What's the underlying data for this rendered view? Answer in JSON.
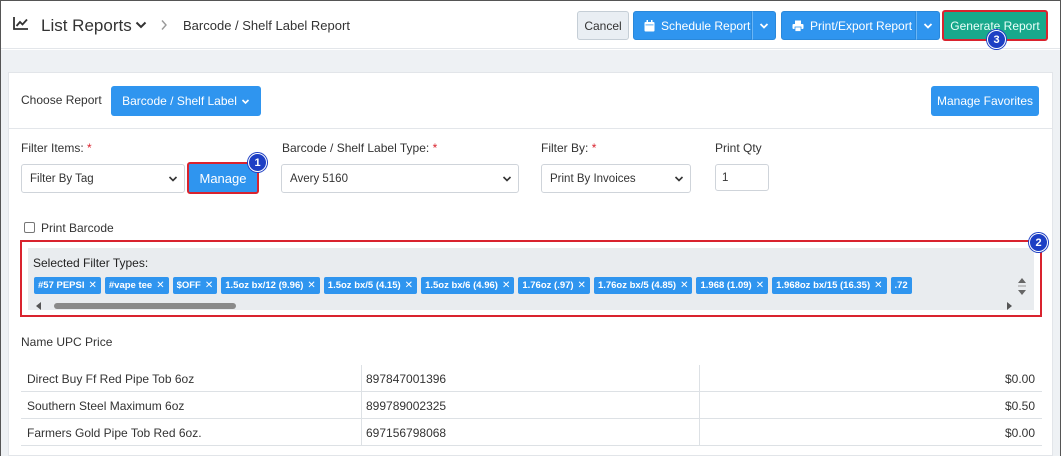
{
  "header": {
    "app_title": "List Reports",
    "breadcrumb": "Barcode / Shelf Label Report",
    "cancel_label": "Cancel",
    "schedule_label": "Schedule Report",
    "print_export_label": "Print/Export Report",
    "generate_label": "Generate Report"
  },
  "controls": {
    "choose_report_label": "Choose Report",
    "report_dropdown_label": "Barcode / Shelf Label",
    "manage_favorites_label": "Manage Favorites",
    "filter_items_label": "Filter Items:",
    "filter_items_value": "Filter By Tag",
    "manage_label": "Manage",
    "label_type_label": "Barcode / Shelf Label Type:",
    "label_type_value": "Avery 5160",
    "filter_by_label": "Filter By:",
    "filter_by_value": "Print By Invoices",
    "print_qty_label": "Print Qty",
    "print_qty_value": "1",
    "required_mark": "*",
    "print_barcode_label": "Print Barcode",
    "print_barcode_checked": false
  },
  "filters": {
    "title": "Selected Filter Types:",
    "chips": [
      "#57 PEPSI",
      "#vape tee",
      "$OFF",
      "1.5oz bx/12 (9.96)",
      "1.5oz bx/5 (4.15)",
      "1.5oz bx/6 (4.96)",
      "1.76oz (.97)",
      "1.76oz bx/5 (4.85)",
      "1.968 (1.09)",
      "1.968oz bx/15 (16.35)",
      ".72"
    ]
  },
  "callouts": [
    "1",
    "2",
    "3"
  ],
  "table": {
    "headers": {
      "name": "Name",
      "upc": "UPC",
      "price": "Price"
    },
    "rows": [
      {
        "name": "Direct Buy Ff Red Pipe Tob 6oz",
        "upc": "897847001396",
        "price": "$0.00"
      },
      {
        "name": "Southern Steel Maximum 6oz",
        "upc": "899789002325",
        "price": "$0.50"
      },
      {
        "name": "Farmers Gold Pipe Tob Red 6oz.",
        "upc": "697156798068",
        "price": "$0.00"
      }
    ]
  },
  "colors": {
    "primary": "#2f95ef",
    "generate": "#18a98c",
    "highlight": "#d9232e",
    "callout": "#1d3fc4"
  }
}
